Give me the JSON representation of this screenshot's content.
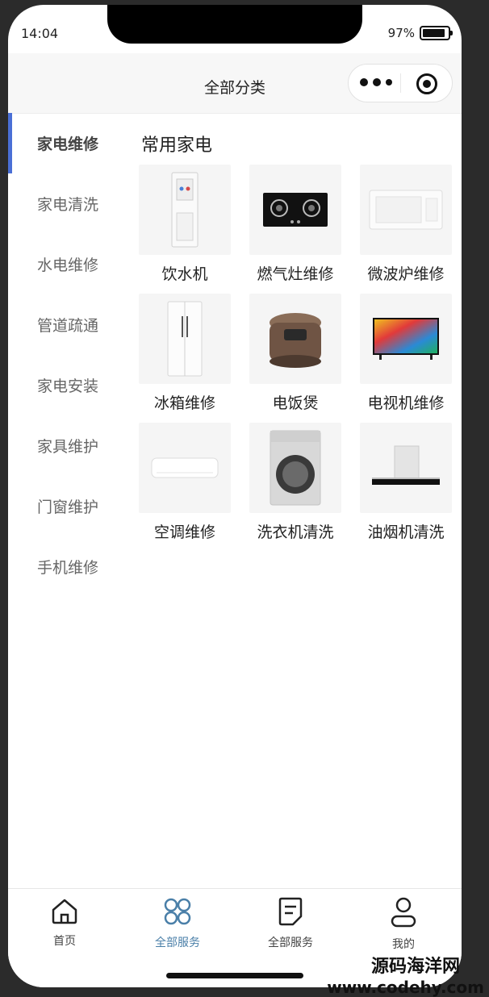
{
  "status_bar": {
    "time": "14:04",
    "battery": "97%",
    "battery_level": 0.97
  },
  "navbar": {
    "title": "全部分类"
  },
  "sidebar": {
    "items": [
      {
        "label": "家电维修",
        "active": true
      },
      {
        "label": "家电清洗"
      },
      {
        "label": "水电维修"
      },
      {
        "label": "管道疏通"
      },
      {
        "label": "家电安装"
      },
      {
        "label": "家具维护"
      },
      {
        "label": "门窗维护"
      },
      {
        "label": "手机维修"
      }
    ]
  },
  "content": {
    "section_title": "常用家电",
    "items": [
      {
        "label": "饮水机",
        "icon": "water-dispenser-icon"
      },
      {
        "label": "燃气灶维修",
        "icon": "gas-stove-icon"
      },
      {
        "label": "微波炉维修",
        "icon": "microwave-icon"
      },
      {
        "label": "冰箱维修",
        "icon": "refrigerator-icon"
      },
      {
        "label": "电饭煲",
        "icon": "rice-cooker-icon"
      },
      {
        "label": "电视机维修",
        "icon": "television-icon"
      },
      {
        "label": "空调维修",
        "icon": "air-conditioner-icon"
      },
      {
        "label": "洗衣机清洗",
        "icon": "washing-machine-icon"
      },
      {
        "label": "油烟机清洗",
        "icon": "range-hood-icon"
      }
    ]
  },
  "tabbar": {
    "tabs": [
      {
        "label": "首页",
        "icon": "home-icon"
      },
      {
        "label": "全部服务",
        "icon": "grid-icon",
        "active": true
      },
      {
        "label": "全部服务",
        "icon": "note-icon"
      },
      {
        "label": "我的",
        "icon": "user-icon"
      }
    ]
  },
  "watermark": {
    "line1": "源码海洋网",
    "line2": "www.codehy.com"
  },
  "colors": {
    "accent": "#4a6fd6",
    "tab_active": "#4a7fa8"
  }
}
